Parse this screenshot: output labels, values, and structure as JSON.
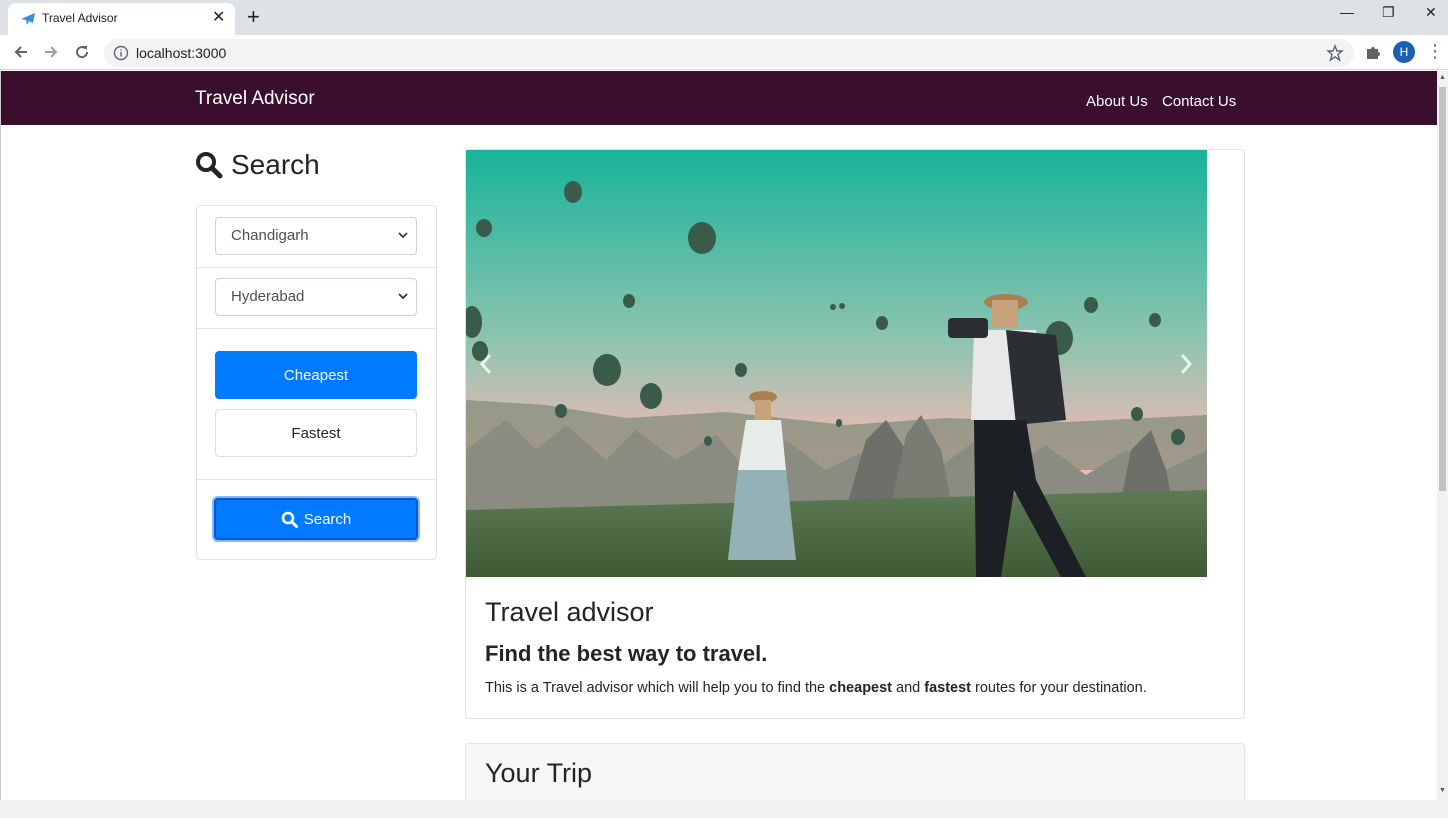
{
  "browser": {
    "tab_title": "Travel Advisor",
    "url": "localhost:3000",
    "profile_initial": "H",
    "icons": [
      "airplane-icon",
      "close-icon",
      "plus-icon",
      "back-icon",
      "forward-icon",
      "reload-icon",
      "info-icon",
      "star-icon",
      "puzzle-icon",
      "menu-icon"
    ]
  },
  "navbar": {
    "brand": "Travel Advisor",
    "links": [
      "About Us",
      "Contact Us"
    ],
    "bg_color": "#3a0f2e"
  },
  "search": {
    "title": "Search",
    "from_value": "Chandigarh",
    "to_value": "Hyderabad",
    "cheapest_label": "Cheapest",
    "fastest_label": "Fastest",
    "search_button_label": "Search",
    "accent_color": "#007bff"
  },
  "main_card": {
    "title": "Travel advisor",
    "subtitle": "Find the best way to travel.",
    "text_before": "This is a Travel advisor which will help you to find the ",
    "bold1": "cheapest",
    "text_middle": " and ",
    "bold2": "fastest",
    "text_after": " routes for your destination."
  },
  "trip": {
    "title": "Your Trip"
  }
}
